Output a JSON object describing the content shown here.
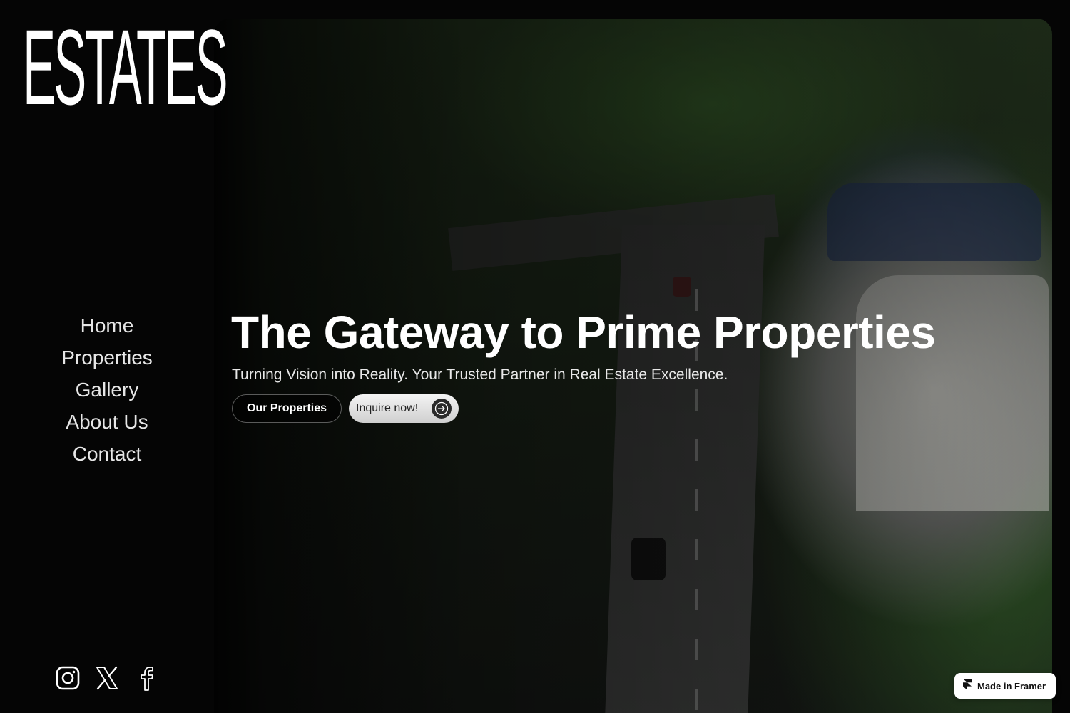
{
  "brand": {
    "logo_text": "ESTATES"
  },
  "nav": {
    "items": [
      {
        "label": "Home"
      },
      {
        "label": "Properties"
      },
      {
        "label": "Gallery"
      },
      {
        "label": "About Us"
      },
      {
        "label": "Contact"
      }
    ]
  },
  "hero": {
    "title": "The Gateway to Prime Properties",
    "subtitle": "Turning Vision into Reality. Your Trusted Partner in Real Estate Excellence.",
    "primary_button": "Our Properties",
    "secondary_button": "Inquire now!",
    "secondary_icon": "arrow-right-circle-icon"
  },
  "socials": [
    {
      "icon": "instagram-icon"
    },
    {
      "icon": "x-twitter-icon"
    },
    {
      "icon": "facebook-icon"
    }
  ],
  "badge": {
    "label": "Made in Framer",
    "icon": "framer-icon"
  },
  "colors": {
    "background": "#050505",
    "text": "#ffffff",
    "button_light": "#e6e6e6"
  }
}
